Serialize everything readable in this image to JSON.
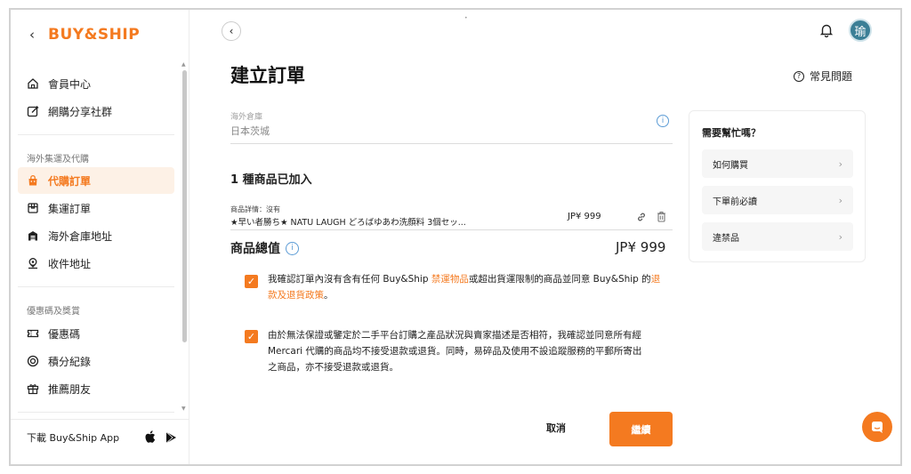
{
  "brand": {
    "logo": "BUY&SHIP"
  },
  "sidebar": {
    "top_items": [
      {
        "label": "會員中心",
        "icon": "home-icon"
      },
      {
        "label": "網購分享社群",
        "icon": "edit-icon"
      }
    ],
    "section1_title": "海外集運及代購",
    "section1_items": [
      {
        "label": "代購訂單",
        "icon": "bag-icon",
        "active": true
      },
      {
        "label": "集運訂單",
        "icon": "box-icon"
      },
      {
        "label": "海外倉庫地址",
        "icon": "warehouse-icon"
      },
      {
        "label": "收件地址",
        "icon": "location-icon"
      }
    ],
    "section2_title": "優惠碼及獎賞",
    "section2_items": [
      {
        "label": "優惠碼",
        "icon": "coupon-icon"
      },
      {
        "label": "積分紀錄",
        "icon": "points-icon"
      },
      {
        "label": "推薦朋友",
        "icon": "gift-icon"
      }
    ],
    "app_label": "下載 Buy&Ship App"
  },
  "header": {
    "avatar_initial": "瑜",
    "faq_label": "常見問題"
  },
  "main": {
    "title": "建立訂單",
    "warehouse_label": "海外倉庫",
    "warehouse_value": "日本茨城",
    "items_added": "1 種商品已加入",
    "product": {
      "detail_label": "商品詳情：沒有",
      "name": "★早い者勝ち★ NATU LAUGH どろばゆあわ洗顔料 3個セッ...",
      "price": "JP¥ 999"
    },
    "total_label": "商品總值",
    "total_value": "JP¥ 999",
    "agreement1": {
      "part1": "我確認訂單內沒有含有任何 Buy&Ship ",
      "link1": "禁運物品",
      "part2": "或超出貨運限制的商品並同意 Buy&Ship 的",
      "link2a": "退",
      "link2b": "款及退貨政策",
      "part3": "。"
    },
    "agreement2": {
      "line1": "由於無法保證或鑒定於二手平台訂購之產品狀況與賣家描述是否相符，我確認並同意所有經",
      "line2": "Mercari 代購的商品均不接受退款或退貨。同時，易碎品及使用不設追蹤服務的平郵所寄出",
      "line3": "之商品，亦不接受退款或退貨。"
    },
    "cancel_label": "取消",
    "continue_label": "繼續"
  },
  "help": {
    "title": "需要幫忙嗎？",
    "items": [
      "如何購買",
      "下單前必讀",
      "違禁品"
    ]
  },
  "colors": {
    "accent": "#f47a20",
    "info": "#5b9bd5",
    "avatar": "#3b7f96"
  }
}
